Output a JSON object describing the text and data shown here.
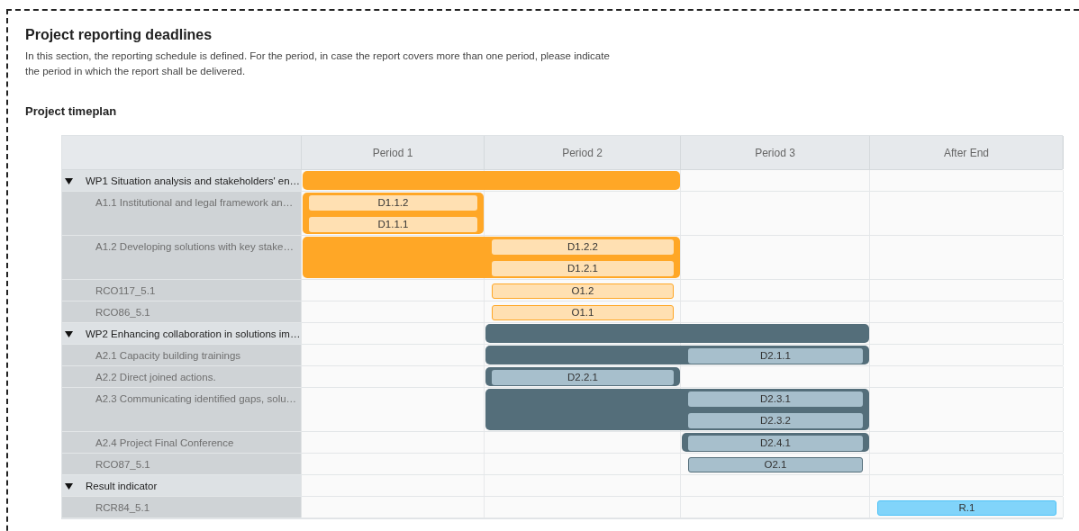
{
  "title": "Project reporting deadlines",
  "description": "In this section, the reporting schedule is defined. For the period, in case the report covers more than one period, please indicate the period in which the report shall be delivered.",
  "timeplan": {
    "title": "Project timeplan",
    "columns": [
      "Period 1",
      "Period 2",
      "Period 3",
      "After End"
    ],
    "rows": [
      {
        "kind": "group",
        "label": "WP1 Situation analysis and stakeholders' en…",
        "expanded": true,
        "color": "#ffa726",
        "cells": [
          {
            "bar": true
          },
          {
            "bar": true
          },
          {
            "bar": false
          },
          {
            "bar": false
          }
        ]
      },
      {
        "kind": "activity",
        "label": "A1.1 Institutional and legal framework an…",
        "color": "#ffa726",
        "cells": [
          {
            "bar": true,
            "items": [
              {
                "label": "D1.1.2",
                "kind": "deliverable",
                "color": "#ffe0b2"
              },
              {
                "label": "D1.1.1",
                "kind": "deliverable",
                "color": "#ffe0b2"
              }
            ]
          },
          {
            "bar": false
          },
          {
            "bar": false
          },
          {
            "bar": false
          }
        ]
      },
      {
        "kind": "activity",
        "label": "A1.2 Developing solutions with key stake…",
        "color": "#ffa726",
        "cells": [
          {
            "bar": true
          },
          {
            "bar": true,
            "items": [
              {
                "label": "D1.2.2",
                "kind": "deliverable",
                "color": "#ffe0b2"
              },
              {
                "label": "D1.2.1",
                "kind": "deliverable",
                "color": "#ffe0b2"
              }
            ]
          },
          {
            "bar": false
          },
          {
            "bar": false
          }
        ]
      },
      {
        "kind": "indicator",
        "label": "RCO117_5.1",
        "color": "#ffa726",
        "cells": [
          {
            "bar": false
          },
          {
            "bar": false,
            "items": [
              {
                "label": "O1.2",
                "kind": "output",
                "color": "#ffe0b2"
              }
            ]
          },
          {
            "bar": false
          },
          {
            "bar": false
          }
        ]
      },
      {
        "kind": "indicator",
        "label": "RCO86_5.1",
        "color": "#ffa726",
        "cells": [
          {
            "bar": false
          },
          {
            "bar": false,
            "items": [
              {
                "label": "O1.1",
                "kind": "output",
                "color": "#ffe0b2"
              }
            ]
          },
          {
            "bar": false
          },
          {
            "bar": false
          }
        ]
      },
      {
        "kind": "group",
        "label": "WP2 Enhancing collaboration in solutions im…",
        "expanded": true,
        "color": "#546e7a",
        "cells": [
          {
            "bar": false
          },
          {
            "bar": true
          },
          {
            "bar": true
          },
          {
            "bar": false
          }
        ]
      },
      {
        "kind": "activity",
        "label": "A2.1 Capacity building trainings",
        "color": "#546e7a",
        "cells": [
          {
            "bar": false
          },
          {
            "bar": true
          },
          {
            "bar": true,
            "items": [
              {
                "label": "D2.1.1",
                "kind": "deliverable",
                "color": "#a7bfcc"
              }
            ]
          },
          {
            "bar": false
          }
        ]
      },
      {
        "kind": "activity",
        "label": "A2.2 Direct joined actions.",
        "color": "#546e7a",
        "cells": [
          {
            "bar": false
          },
          {
            "bar": true,
            "items": [
              {
                "label": "D2.2.1",
                "kind": "deliverable",
                "color": "#a7bfcc"
              }
            ]
          },
          {
            "bar": false
          },
          {
            "bar": false
          }
        ]
      },
      {
        "kind": "activity",
        "label": "A2.3 Communicating identified gaps, solu…",
        "color": "#546e7a",
        "cells": [
          {
            "bar": false
          },
          {
            "bar": true
          },
          {
            "bar": true,
            "items": [
              {
                "label": "D2.3.1",
                "kind": "deliverable",
                "color": "#a7bfcc"
              },
              {
                "label": "D2.3.2",
                "kind": "deliverable",
                "color": "#a7bfcc"
              }
            ]
          },
          {
            "bar": false
          }
        ]
      },
      {
        "kind": "activity",
        "label": "A2.4 Project Final Conference",
        "color": "#546e7a",
        "cells": [
          {
            "bar": false
          },
          {
            "bar": false
          },
          {
            "bar": true,
            "items": [
              {
                "label": "D2.4.1",
                "kind": "deliverable",
                "color": "#a7bfcc"
              }
            ]
          },
          {
            "bar": false
          }
        ]
      },
      {
        "kind": "indicator",
        "label": "RCO87_5.1",
        "color": "#546e7a",
        "cells": [
          {
            "bar": false
          },
          {
            "bar": false
          },
          {
            "bar": false,
            "items": [
              {
                "label": "O2.1",
                "kind": "output",
                "color": "#a7bfcc"
              }
            ]
          },
          {
            "bar": false
          }
        ]
      },
      {
        "kind": "group",
        "label": "Result indicator",
        "expanded": true,
        "cells": [
          {
            "bar": false
          },
          {
            "bar": false
          },
          {
            "bar": false
          },
          {
            "bar": false
          }
        ]
      },
      {
        "kind": "indicator",
        "label": "RCR84_5.1",
        "color": "#4fc3f7",
        "cells": [
          {
            "bar": false
          },
          {
            "bar": false
          },
          {
            "bar": false
          },
          {
            "bar": false,
            "items": [
              {
                "label": "R.1",
                "kind": "output",
                "color": "#81d4fa"
              }
            ]
          }
        ]
      }
    ]
  }
}
